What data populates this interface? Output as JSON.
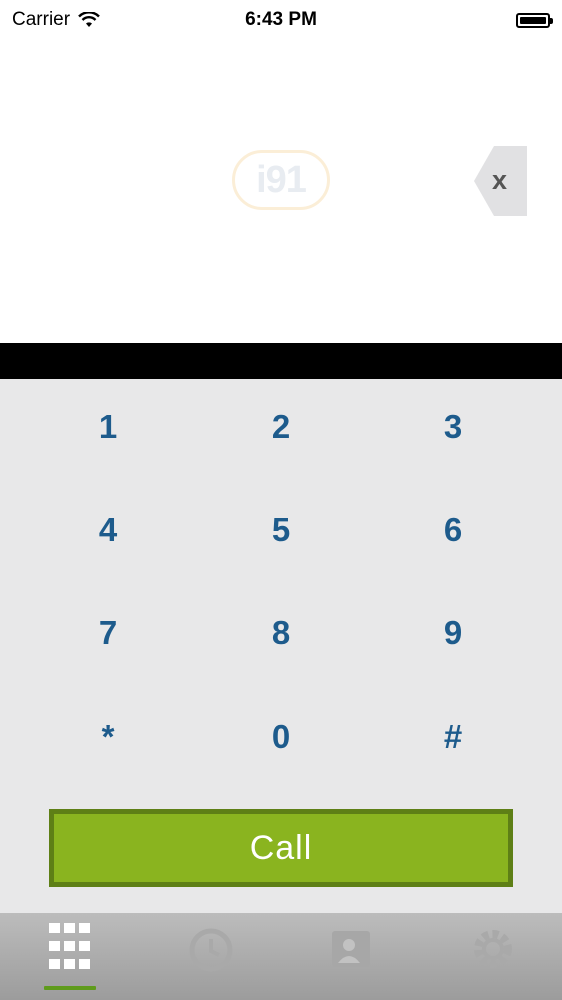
{
  "status_bar": {
    "carrier": "Carrier",
    "time": "6:43 PM",
    "wifi_icon": "wifi-icon",
    "battery_icon": "battery-icon"
  },
  "display": {
    "logo_text": "i91",
    "delete_label": "x"
  },
  "keypad": {
    "keys": [
      "1",
      "2",
      "3",
      "4",
      "5",
      "6",
      "7",
      "8",
      "9",
      "*",
      "0",
      "#"
    ],
    "call_label": "Call",
    "call_color": "#8ab41f",
    "digit_color": "#1d5b8c"
  },
  "tab_bar": {
    "tabs": [
      {
        "icon": "keypad-icon",
        "active": true
      },
      {
        "icon": "recents-clock-icon",
        "active": false
      },
      {
        "icon": "contacts-icon",
        "active": false
      },
      {
        "icon": "settings-gear-icon",
        "active": false
      }
    ],
    "active_color": "#5f9b1c"
  }
}
